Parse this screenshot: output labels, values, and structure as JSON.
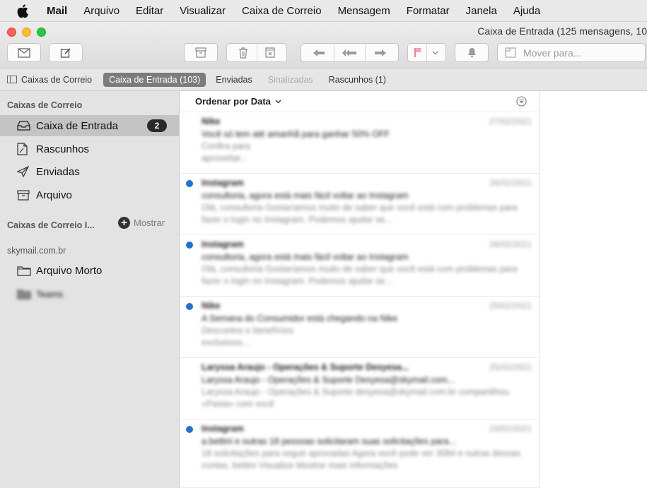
{
  "menubar": {
    "app": "Mail",
    "items": [
      "Arquivo",
      "Editar",
      "Visualizar",
      "Caixa de Correio",
      "Mensagem",
      "Formatar",
      "Janela",
      "Ajuda"
    ]
  },
  "window": {
    "title": "Caixa de Entrada (125 mensagens, 10"
  },
  "toolbar": {
    "move_placeholder": "Mover para..."
  },
  "favorites": {
    "mailboxes": "Caixas de Correio",
    "inbox": "Caixa de Entrada (103)",
    "sent": "Enviadas",
    "flagged": "Sinalizadas",
    "drafts": "Rascunhos (1)"
  },
  "sidebar": {
    "section1": "Caixas de Correio",
    "items": [
      {
        "label": "Caixa de Entrada",
        "badge": "2"
      },
      {
        "label": "Rascunhos"
      },
      {
        "label": "Enviadas"
      },
      {
        "label": "Arquivo"
      }
    ],
    "section2": "Caixas de Correio I...",
    "show": "Mostrar",
    "section3": "skymail.com.br",
    "account_items": [
      {
        "label": "Arquivo Morto"
      },
      {
        "label": "Teams"
      }
    ]
  },
  "list": {
    "sort_label": "Ordenar por Data",
    "messages": [
      {
        "sender": "Nike",
        "date": "27/02/2021",
        "subject": "Você só tem até amanhã para ganhar 50% OFF",
        "preview": "Confira para aproveitar...",
        "unread": false
      },
      {
        "sender": "Instagram",
        "date": "26/02/2021",
        "subject": "consultoria, agora está mais fácil voltar ao Instagram",
        "preview": "Olá, consultoria Gostaríamos muito de saber que você está com problemas para fazer o login no Instagram. Podemos ajudar se...",
        "unread": true
      },
      {
        "sender": "Instagram",
        "date": "26/02/2021",
        "subject": "consultoria, agora está mais fácil voltar ao Instagram",
        "preview": "Olá, consultoria Gostaríamos muito de saber que você está com problemas para fazer o login no Instagram. Podemos ajudar se...",
        "unread": true
      },
      {
        "sender": "Nike",
        "date": "25/02/2021",
        "subject": "A Semana do Consumidor está chegando na Nike",
        "preview": "Descontos e benefícios exclusivos...",
        "unread": true
      },
      {
        "sender": "Laryssa Araujo - Operações & Suporte Desyesa...",
        "date": "25/02/2021",
        "subject": "Laryssa Araujo - Operações & Suporte Desyesa@skymail.com...",
        "preview": "Laryssa Araujo - Operações & Suporte desyesa@skymail.com.br compartilhou «Pasta» com você",
        "unread": false
      },
      {
        "sender": "Instagram",
        "date": "23/02/2021",
        "subject": "a.bettini e outras 18 pessoas solicitaram suas solicitações para...",
        "preview": "18 solicitações para seguir aprovadas Agora você pode ver 3084 e outras dessas contas, bettini Visualize Mostrar mais informações",
        "unread": true
      }
    ]
  },
  "colors": {
    "unread_dot": "#1e73d8",
    "selected_row": "#c4c4c4",
    "active_tab": "#7c7c7c"
  }
}
